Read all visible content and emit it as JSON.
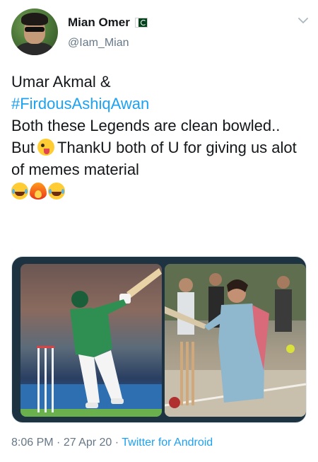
{
  "user": {
    "display_name": "Mian Omer",
    "handle": "@Iam_Mian",
    "flag_icon": "pakistan-flag-icon"
  },
  "tweet": {
    "line1": "Umar Akmal &",
    "hashtag": "#FirdousAshiqAwan",
    "line3": "Both these Legends are clean bowled..",
    "line4_before": "But",
    "line4_after": "ThankU both of U  for giving us alot of  memes material",
    "emojis": [
      "winking-tongue-emoji",
      "laughing-tears-emoji",
      "fire-emoji",
      "laughing-tears-emoji"
    ]
  },
  "footer": {
    "time": "8:06 PM",
    "separator1": " · ",
    "date": "27 Apr 20",
    "separator2": " · ",
    "source": "Twitter for Android"
  },
  "colors": {
    "link": "#1da1f2",
    "secondary_text": "#657786",
    "primary_text": "#14171a"
  }
}
